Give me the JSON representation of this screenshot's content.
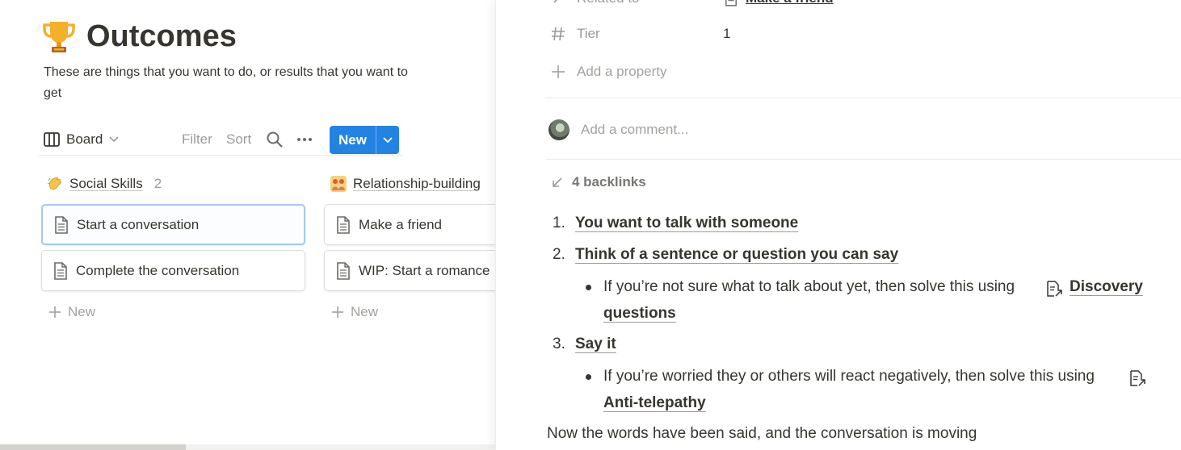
{
  "left": {
    "title": "Outcomes",
    "description": "These are things that you want to do, or results that you want to get",
    "toolbar": {
      "view_label": "Board",
      "filter_label": "Filter",
      "sort_label": "Sort",
      "new_label": "New"
    },
    "columns": [
      {
        "label": "Social Skills",
        "count": "2",
        "cards": [
          "Start a conversation",
          "Complete the conversation"
        ],
        "add_label": "New"
      },
      {
        "label": "Relationship-building",
        "count": "",
        "cards": [
          "Make a friend",
          "WIP: Start a romance"
        ],
        "add_label": "New"
      }
    ]
  },
  "right": {
    "properties": [
      {
        "name": "Related to",
        "value": "Make a friend",
        "icon": "page-icon"
      },
      {
        "name": "Tier",
        "value": "1",
        "icon": "hash-icon"
      }
    ],
    "add_property_label": "Add a property",
    "comment_placeholder": "Add a comment...",
    "backlinks_label": "4 backlinks",
    "list": [
      {
        "num": "1.",
        "text": "You want to talk with someone"
      },
      {
        "num": "2.",
        "text": "Think of a sentence or question you can say"
      },
      {
        "num": "3.",
        "text": "Say it"
      }
    ],
    "sub_items": [
      {
        "text": "If you’re not sure what to talk about yet, then solve this using",
        "link_part1": "Discovery",
        "link_part2": "questions"
      },
      {
        "text": "If you’re worried they or others will react negatively, then solve this using",
        "link_part2": "Anti-telepathy"
      }
    ],
    "paragraph": "Now the words have been said, and the conversation is moving"
  }
}
